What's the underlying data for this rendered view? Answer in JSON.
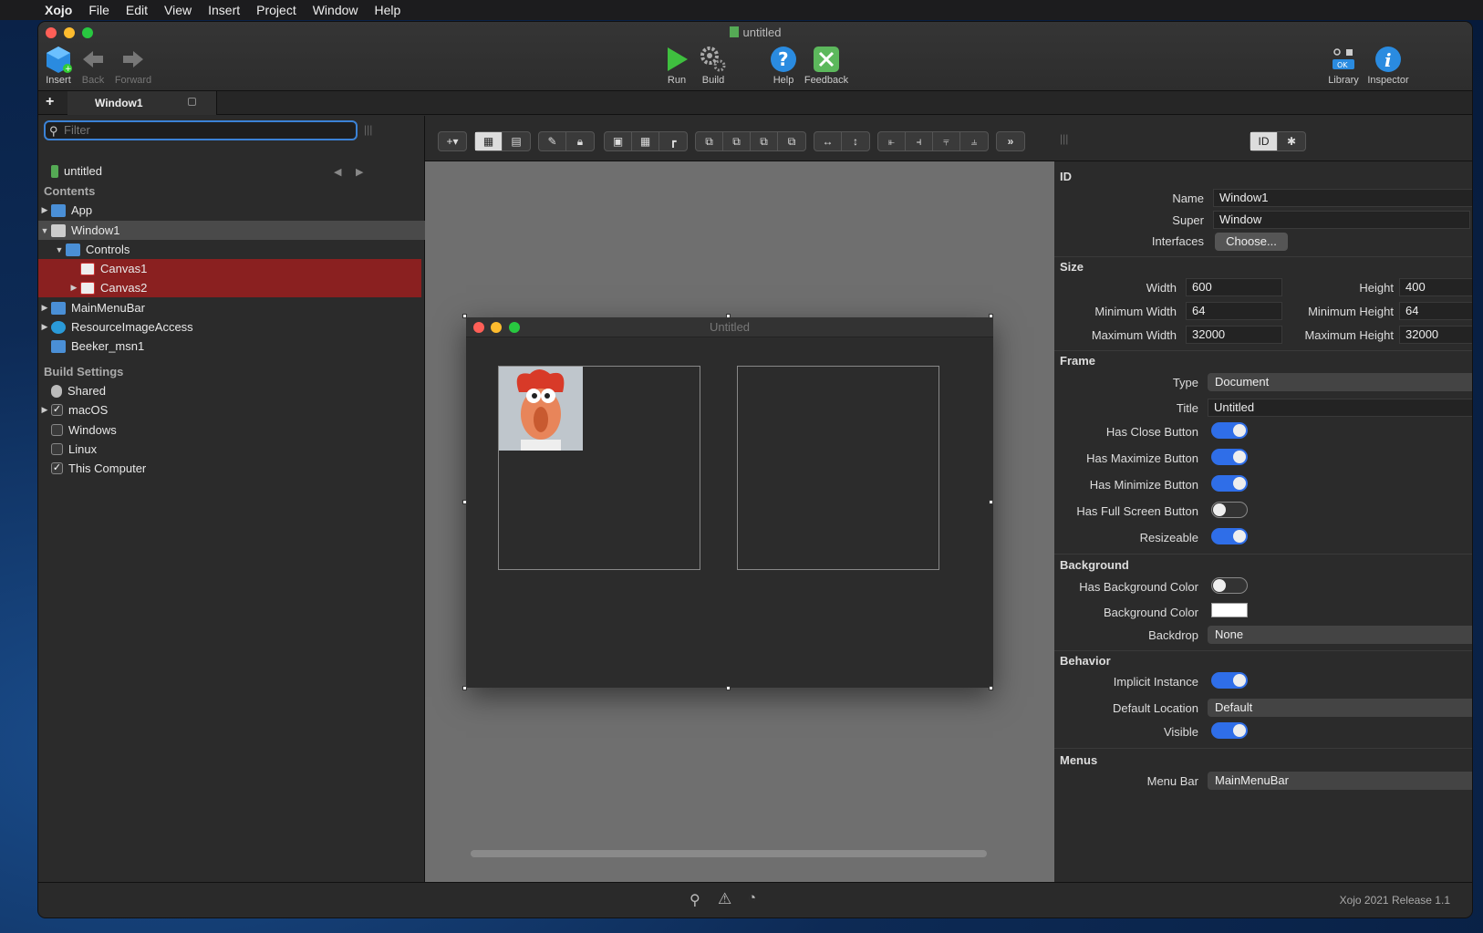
{
  "menubar": {
    "app": "Xojo",
    "items": [
      "File",
      "Edit",
      "View",
      "Insert",
      "Project",
      "Window",
      "Help"
    ]
  },
  "window": {
    "title": "untitled"
  },
  "toolbar": {
    "insert": "Insert",
    "back": "Back",
    "forward": "Forward",
    "run": "Run",
    "build": "Build",
    "help": "Help",
    "feedback": "Feedback",
    "library": "Library",
    "inspector": "Inspector"
  },
  "tab": {
    "label": "Window1"
  },
  "navigator": {
    "filter_placeholder": "Filter",
    "project": "untitled",
    "contents_header": "Contents",
    "items": {
      "app": "App",
      "window1": "Window1",
      "controls": "Controls",
      "canvas1": "Canvas1",
      "canvas2": "Canvas2",
      "mainmenubar": "MainMenuBar",
      "resource": "ResourceImageAccess",
      "beeker": "Beeker_msn1"
    },
    "build_header": "Build Settings",
    "build": {
      "shared": "Shared",
      "macos": "macOS",
      "windows": "Windows",
      "linux": "Linux",
      "this_computer": "This Computer"
    }
  },
  "designer": {
    "window_title": "Untitled"
  },
  "inspector": {
    "id_header": "ID",
    "name_label": "Name",
    "name_value": "Window1",
    "super_label": "Super",
    "super_value": "Window",
    "interfaces_label": "Interfaces",
    "interfaces_button": "Choose...",
    "size_header": "Size",
    "width_label": "Width",
    "width_value": "600",
    "height_label": "Height",
    "height_value": "400",
    "minw_label": "Minimum Width",
    "minw_value": "64",
    "minh_label": "Minimum Height",
    "minh_value": "64",
    "maxw_label": "Maximum Width",
    "maxw_value": "32000",
    "maxh_label": "Maximum Height",
    "maxh_value": "32000",
    "frame_header": "Frame",
    "type_label": "Type",
    "type_value": "Document",
    "title_label": "Title",
    "title_value": "Untitled",
    "close_label": "Has Close Button",
    "max_label": "Has Maximize Button",
    "min_label": "Has Minimize Button",
    "full_label": "Has Full Screen Button",
    "resize_label": "Resizeable",
    "bg_header": "Background",
    "hasbg_label": "Has Background Color",
    "bgcolor_label": "Background Color",
    "backdrop_label": "Backdrop",
    "backdrop_value": "None",
    "behavior_header": "Behavior",
    "implicit_label": "Implicit Instance",
    "defloc_label": "Default Location",
    "defloc_value": "Default",
    "visible_label": "Visible",
    "menus_header": "Menus",
    "menubar_label": "Menu Bar",
    "menubar_value": "MainMenuBar"
  },
  "status": {
    "version": "Xojo 2021 Release 1.1"
  }
}
